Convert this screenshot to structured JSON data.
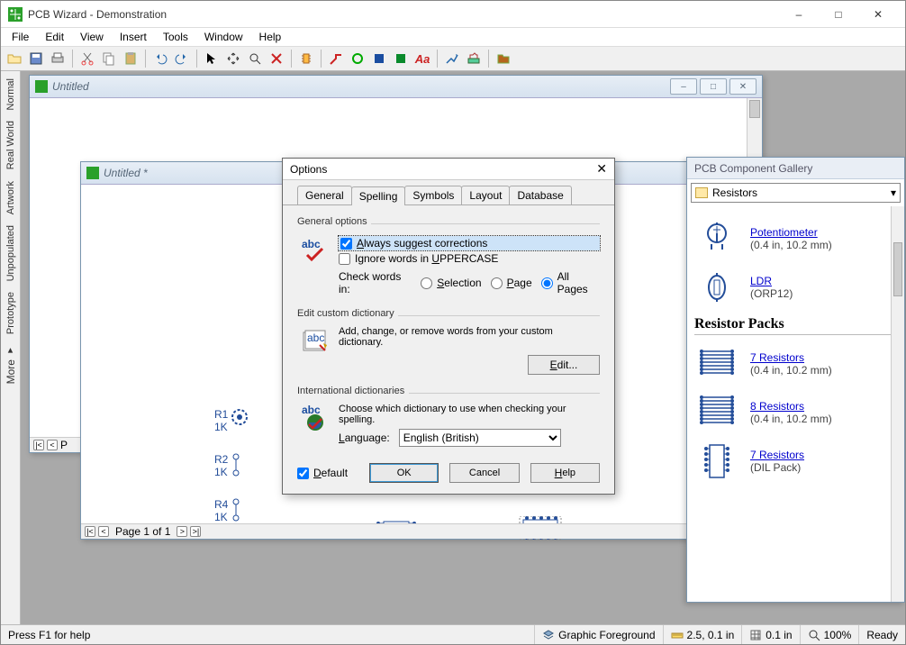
{
  "app": {
    "title": "PCB Wizard - Demonstration"
  },
  "menu": [
    "File",
    "Edit",
    "View",
    "Insert",
    "Tools",
    "Window",
    "Help"
  ],
  "left_tabs": [
    "Normal",
    "Real World",
    "Artwork",
    "Unpopulated",
    "Prototype",
    "More"
  ],
  "doc1": {
    "title": "Untitled",
    "page_label": "P"
  },
  "doc2": {
    "title": "Untitled *",
    "page_label": "Page 1 of 1"
  },
  "gallery": {
    "title": "PCB Component Gallery",
    "category": "Resistors",
    "items_top": [
      {
        "name": "Potentiometer",
        "sub": "(0.4 in, 10.2 mm)"
      },
      {
        "name": "LDR",
        "sub": "(ORP12)"
      }
    ],
    "section": "Resistor Packs",
    "items_bottom": [
      {
        "name": "7 Resistors",
        "sub": "(0.4 in, 10.2 mm)"
      },
      {
        "name": "8 Resistors",
        "sub": "(0.4 in, 10.2 mm)"
      },
      {
        "name": "7 Resistors",
        "sub": "(DIL Pack)"
      }
    ]
  },
  "dialog": {
    "title": "Options",
    "tabs": [
      "General",
      "Spelling",
      "Symbols",
      "Layout",
      "Database"
    ],
    "active_tab": "Spelling",
    "grp_general": "General options",
    "opt_suggest": "Always suggest corrections",
    "opt_ignore": "Ignore words in UPPERCASE",
    "check_label": "Check words in:",
    "radio_sel": "Selection",
    "radio_page": "Page",
    "radio_all": "All Pages",
    "grp_dict": "Edit custom dictionary",
    "dict_text": "Add, change, or remove words from your custom dictionary.",
    "btn_edit": "Edit...",
    "grp_intl": "International dictionaries",
    "intl_text": "Choose which dictionary to use when checking your spelling.",
    "lang_label": "Language:",
    "lang_value": "English (British)",
    "chk_default": "Default",
    "btn_ok": "OK",
    "btn_cancel": "Cancel",
    "btn_help": "Help"
  },
  "status": {
    "hint": "Press F1 for help",
    "layer": "Graphic Foreground",
    "ruler": "2.5, 0.1 in",
    "grid": "0.1 in",
    "zoom": "100%",
    "ready": "Ready"
  },
  "canvas_labels": {
    "r1": "R1",
    "r1v": "1K",
    "r2": "R2",
    "r2v": "1K",
    "r4": "R4",
    "r4v": "1K"
  }
}
